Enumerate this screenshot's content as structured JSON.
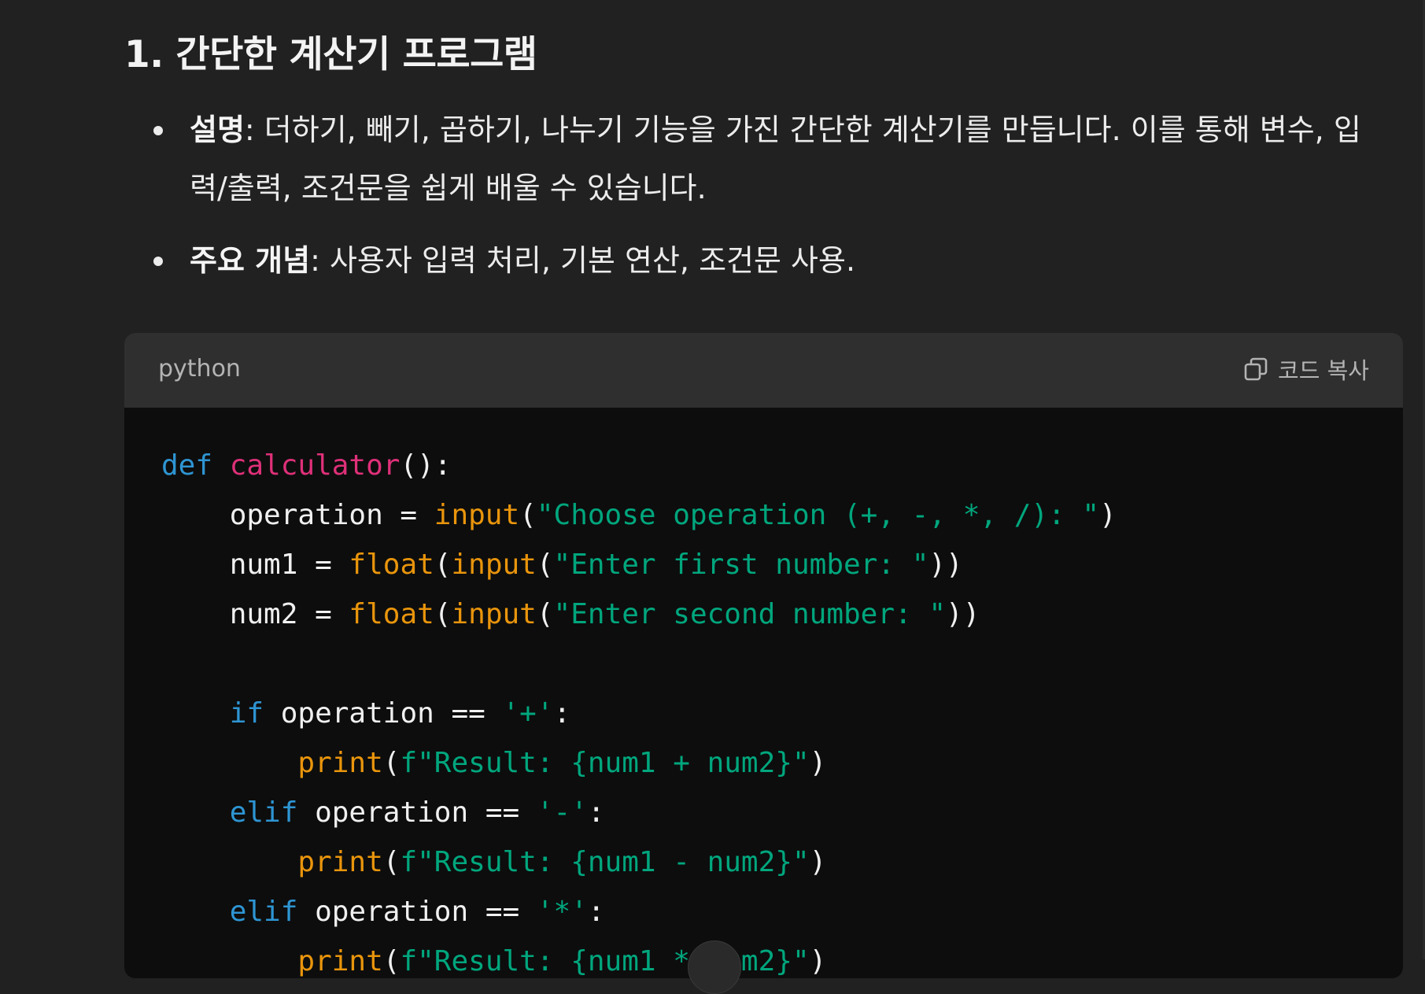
{
  "section": {
    "title": "1. 간단한 계산기 프로그램"
  },
  "bullets": [
    {
      "label": "설명",
      "text": ": 더하기, 빼기, 곱하기, 나누기 기능을 가진 간단한 계산기를 만듭니다. 이를 통해 변수, 입력/출력, 조건문을 쉽게 배울 수 있습니다."
    },
    {
      "label": "주요 개념",
      "text": ": 사용자 입력 처리, 기본 연산, 조건문 사용."
    }
  ],
  "code_block": {
    "language": "python",
    "copy_label": "코드 복사",
    "lines": [
      [
        {
          "t": "def",
          "c": "kw"
        },
        {
          "t": " "
        },
        {
          "t": "calculator",
          "c": "fn"
        },
        {
          "t": "():"
        }
      ],
      [
        {
          "t": "    operation = "
        },
        {
          "t": "input",
          "c": "fn2"
        },
        {
          "t": "("
        },
        {
          "t": "\"Choose operation (+, -, *, /): \"",
          "c": "str"
        },
        {
          "t": ")"
        }
      ],
      [
        {
          "t": "    num1 = "
        },
        {
          "t": "float",
          "c": "fn2"
        },
        {
          "t": "("
        },
        {
          "t": "input",
          "c": "fn2"
        },
        {
          "t": "("
        },
        {
          "t": "\"Enter first number: \"",
          "c": "str"
        },
        {
          "t": "))"
        }
      ],
      [
        {
          "t": "    num2 = "
        },
        {
          "t": "float",
          "c": "fn2"
        },
        {
          "t": "("
        },
        {
          "t": "input",
          "c": "fn2"
        },
        {
          "t": "("
        },
        {
          "t": "\"Enter second number: \"",
          "c": "str"
        },
        {
          "t": "))"
        }
      ],
      [
        {
          "t": ""
        }
      ],
      [
        {
          "t": "    "
        },
        {
          "t": "if",
          "c": "kw"
        },
        {
          "t": " operation == "
        },
        {
          "t": "'+'",
          "c": "str"
        },
        {
          "t": ":"
        }
      ],
      [
        {
          "t": "        "
        },
        {
          "t": "print",
          "c": "fn2"
        },
        {
          "t": "("
        },
        {
          "t": "f\"Result: {num1 + num2}\"",
          "c": "str"
        },
        {
          "t": ")"
        }
      ],
      [
        {
          "t": "    "
        },
        {
          "t": "elif",
          "c": "kw"
        },
        {
          "t": " operation == "
        },
        {
          "t": "'-'",
          "c": "str"
        },
        {
          "t": ":"
        }
      ],
      [
        {
          "t": "        "
        },
        {
          "t": "print",
          "c": "fn2"
        },
        {
          "t": "("
        },
        {
          "t": "f\"Result: {num1 - num2}\"",
          "c": "str"
        },
        {
          "t": ")"
        }
      ],
      [
        {
          "t": "    "
        },
        {
          "t": "elif",
          "c": "kw"
        },
        {
          "t": " operation == "
        },
        {
          "t": "'*'",
          "c": "str"
        },
        {
          "t": ":"
        }
      ],
      [
        {
          "t": "        "
        },
        {
          "t": "print",
          "c": "fn2"
        },
        {
          "t": "("
        },
        {
          "t": "f\"Result: {num1 * num2}\"",
          "c": "str"
        },
        {
          "t": ")"
        }
      ]
    ]
  },
  "colors": {
    "background": "#212121",
    "code_background": "#0d0d0d",
    "code_header": "#2f2f2f",
    "keyword": "#2e95d3",
    "function_name": "#df3079",
    "builtin": "#e9950c",
    "string": "#00a67d"
  }
}
